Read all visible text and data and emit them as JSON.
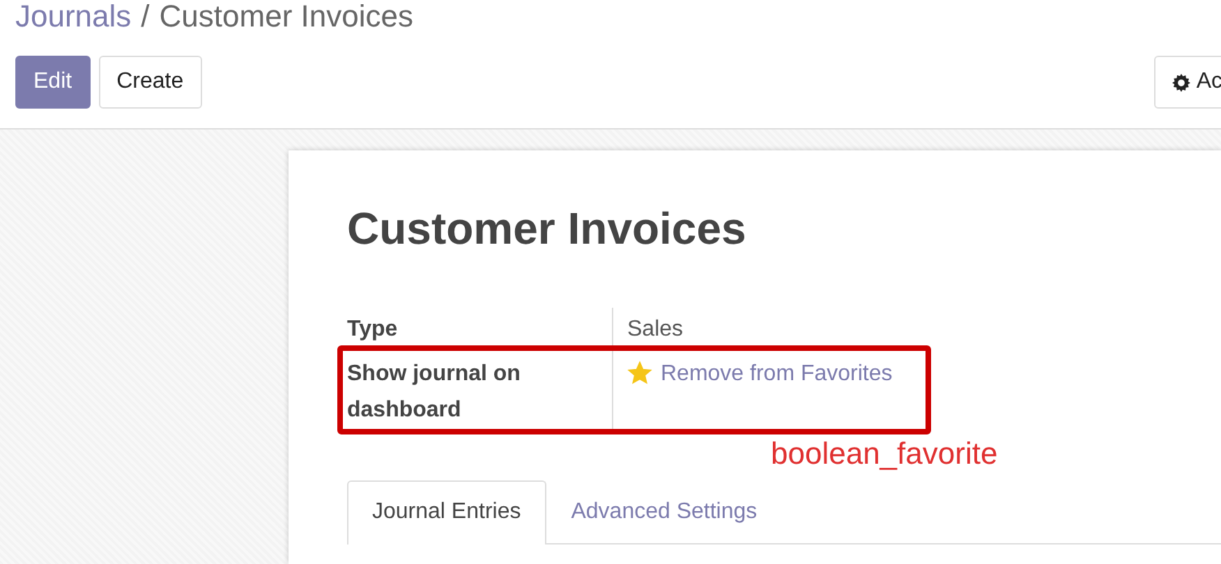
{
  "breadcrumb": {
    "parent": "Journals",
    "separator": "/",
    "current": "Customer Invoices"
  },
  "buttons": [
    {
      "label": "Edit",
      "kind": "primary"
    },
    {
      "label": "Create",
      "kind": "secondary"
    }
  ],
  "action_button": {
    "label": "Ac"
  },
  "record": {
    "title": "Customer Invoices",
    "fields": [
      {
        "label": "Type",
        "kind": "text",
        "value": "Sales"
      },
      {
        "label": "Show journal on dashboard",
        "kind": "favorite",
        "favorite": true,
        "value": "Remove from Favorites"
      }
    ]
  },
  "tabs": [
    {
      "label": "Journal Entries",
      "selected": true
    },
    {
      "label": "Advanced Settings",
      "selected": false
    }
  ],
  "annotation": {
    "label": "boolean_favorite"
  }
}
